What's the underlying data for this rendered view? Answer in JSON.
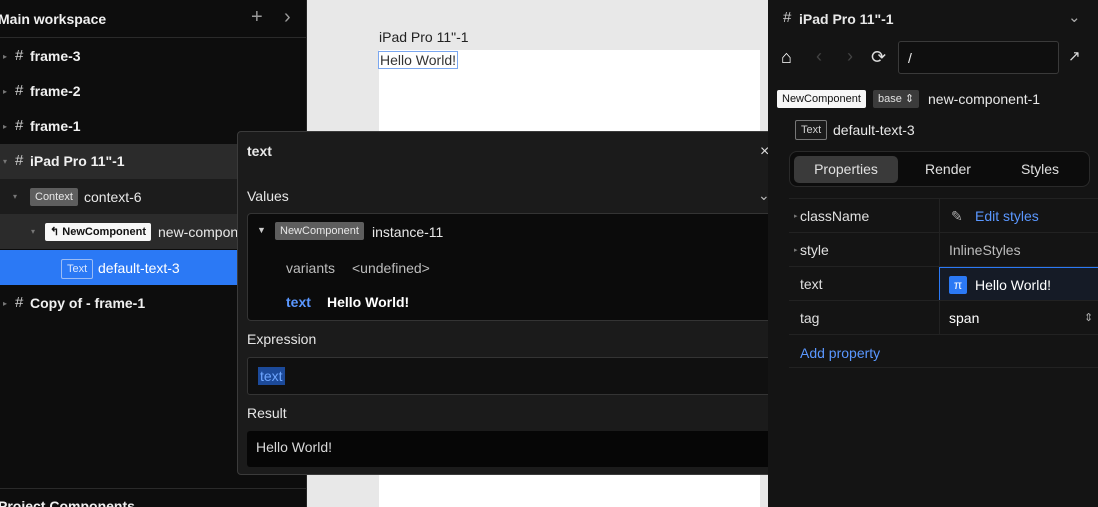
{
  "left": {
    "title": "Main workspace",
    "plus": "+",
    "chev": "›",
    "frames": [
      "frame-3",
      "frame-2",
      "frame-1"
    ],
    "ipad": "iPad Pro 11\"-1",
    "context_tag": "Context",
    "context_name": "context-6",
    "component_tag": "NewComponent",
    "component_name": "new-compon",
    "text_tag": "Text",
    "text_name": "default-text-3",
    "copy_name": "Copy of - frame-1",
    "project_title": "Project Components"
  },
  "canvas": {
    "frame_label": "iPad Pro 11\"-1",
    "hello": "Hello World!"
  },
  "popup": {
    "title": "text",
    "close": "×",
    "values_label": "Values",
    "instance_tag": "NewComponent",
    "instance_name": "instance-11",
    "variants_key": "variants",
    "variants_val": "<undefined>",
    "text_key": "text",
    "text_val": "Hello World!",
    "expression_label": "Expression",
    "expression_token": "text",
    "result_label": "Result",
    "result_val": "Hello World!"
  },
  "right": {
    "title": "iPad Pro 11\"-1",
    "address": "/",
    "comp_tag": "NewComponent",
    "variant": "base",
    "comp_name": "new-component-1",
    "text_tag": "Text",
    "text_name": "default-text-3",
    "tabs": [
      "Properties",
      "Render",
      "Styles"
    ],
    "props": [
      {
        "name": "className",
        "value": "Edit styles"
      },
      {
        "name": "style",
        "value": "InlineStyles"
      },
      {
        "name": "text",
        "value": "Hello World!"
      },
      {
        "name": "tag",
        "value": "span"
      }
    ],
    "add_property": "Add property"
  },
  "colors": {
    "accent": "#2b79f5",
    "link": "#5a97ff",
    "panel": "#0d0d0d"
  }
}
